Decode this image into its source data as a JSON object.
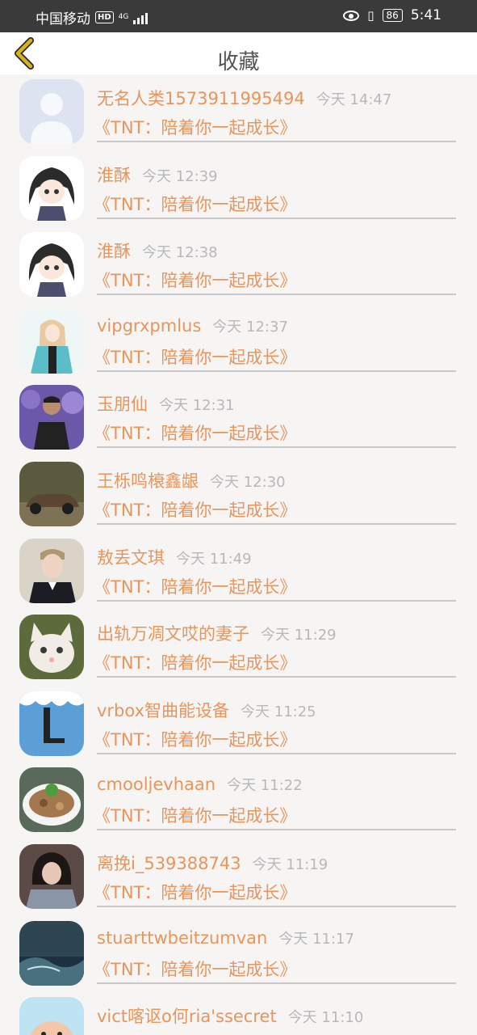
{
  "status": {
    "carrier": "中国移动",
    "hd": "HD",
    "net_type": "4G",
    "battery": "86",
    "time": "5:41"
  },
  "header": {
    "title": "收藏"
  },
  "items": [
    {
      "name": "无名人类1573911995494",
      "time": "今天 14:47",
      "book": "《TNT：陪着你一起成长》"
    },
    {
      "name": "淮酥",
      "time": "今天 12:39",
      "book": "《TNT：陪着你一起成长》"
    },
    {
      "name": "淮酥",
      "time": "今天 12:38",
      "book": "《TNT：陪着你一起成长》"
    },
    {
      "name": "vipgrxpmlus",
      "time": "今天 12:37",
      "book": "《TNT：陪着你一起成长》"
    },
    {
      "name": "玉朋仙",
      "time": "今天 12:31",
      "book": "《TNT：陪着你一起成长》"
    },
    {
      "name": "王栎鸣榱鑫龈",
      "time": "今天 12:30",
      "book": "《TNT：陪着你一起成长》"
    },
    {
      "name": "敖丢文琪",
      "time": "今天 11:49",
      "book": "《TNT：陪着你一起成长》"
    },
    {
      "name": "出轨万凋文哎的妻子",
      "time": "今天 11:29",
      "book": "《TNT：陪着你一起成长》"
    },
    {
      "name": "vrbox智曲能设备",
      "time": "今天 11:25",
      "book": "《TNT：陪着你一起成长》"
    },
    {
      "name": "cmooljevhaan",
      "time": "今天 11:22",
      "book": "《TNT：陪着你一起成长》"
    },
    {
      "name": "离挽i_539388743",
      "time": "今天 11:19",
      "book": "《TNT：陪着你一起成长》"
    },
    {
      "name": "stuarttwbeitzumvan",
      "time": "今天 11:17",
      "book": "《TNT：陪着你一起成长》"
    },
    {
      "name": "vict喀讴o何ria'ssecret",
      "time": "今天 11:10",
      "book": ""
    }
  ],
  "colors": {
    "accent": "#e8955a",
    "back_arrow": "#d8b11e",
    "status_bar": "#3a3a3a",
    "time_text": "#b8b8b8"
  }
}
